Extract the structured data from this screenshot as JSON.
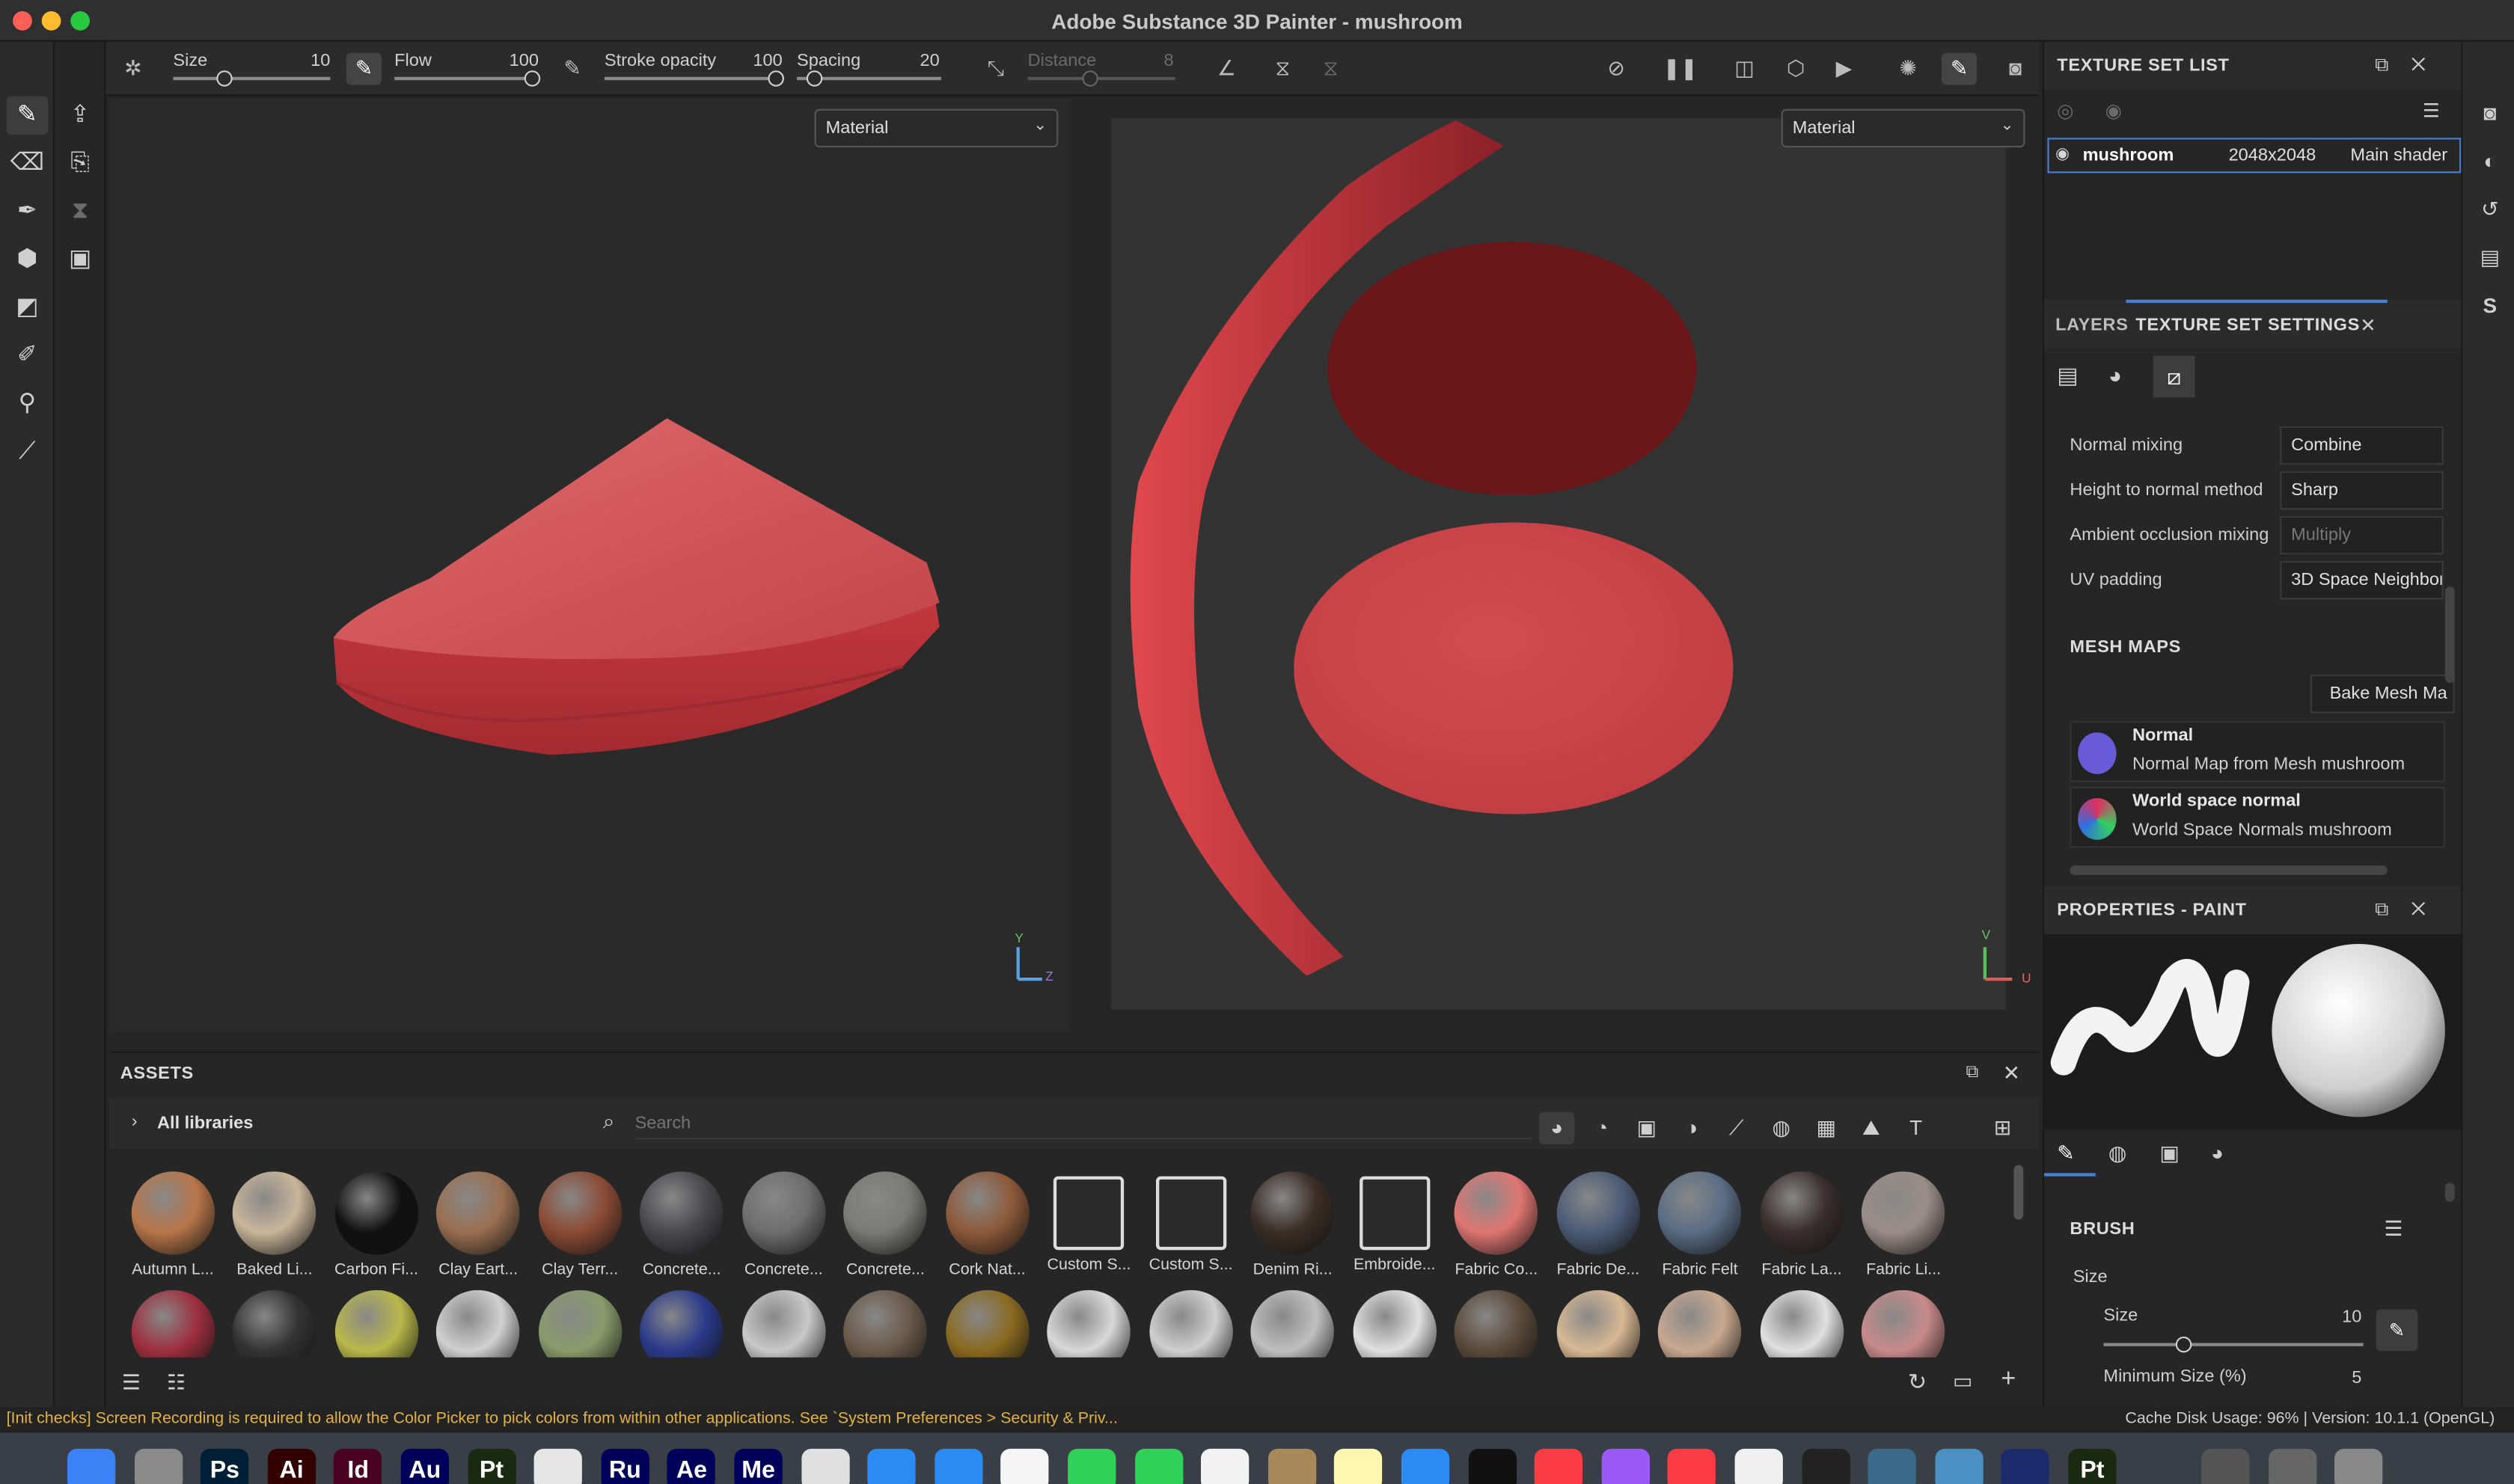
{
  "window": {
    "title": "Adobe Substance 3D Painter - mushroom"
  },
  "toolbar": {
    "size_label": "Size",
    "size_value": "10",
    "flow_label": "Flow",
    "flow_value": "100",
    "stroke_opacity_label": "Stroke opacity",
    "stroke_opacity_value": "100",
    "spacing_label": "Spacing",
    "spacing_value": "20",
    "distance_label": "Distance",
    "distance_value": "8"
  },
  "viewport_3d": {
    "mode": "Material",
    "axis_y": "Y",
    "axis_z": "Z"
  },
  "viewport_2d": {
    "mode": "Material",
    "axis_v": "V",
    "axis_u": "U"
  },
  "assets": {
    "title": "ASSETS",
    "library": "All libraries",
    "search_placeholder": "Search",
    "row1": [
      {
        "label": "Autumn L...",
        "color": "#b8764a"
      },
      {
        "label": "Baked Li...",
        "color": "#c9b59a"
      },
      {
        "label": "Carbon Fi...",
        "color": "#111111"
      },
      {
        "label": "Clay Eart...",
        "color": "#9a6f52"
      },
      {
        "label": "Clay Terr...",
        "color": "#8c4b35"
      },
      {
        "label": "Concrete...",
        "color": "#4a4a4e"
      },
      {
        "label": "Concrete...",
        "color": "#6e6e6e"
      },
      {
        "label": "Concrete...",
        "color": "#7a7a76"
      },
      {
        "label": "Cork Nat...",
        "color": "#8e5a3a"
      },
      {
        "label": "Custom S...",
        "color": "#dcdcdc"
      },
      {
        "label": "Custom S...",
        "color": "#dcdcdc"
      },
      {
        "label": "Denim Ri...",
        "color": "#3a2e26"
      },
      {
        "label": "Embroide...",
        "color": "#dcdcdc"
      },
      {
        "label": "Fabric Co...",
        "color": "#e07672"
      },
      {
        "label": "Fabric De...",
        "color": "#4c5d78"
      },
      {
        "label": "Fabric Felt",
        "color": "#5a6e86"
      },
      {
        "label": "Fabric La...",
        "color": "#3a2e2e"
      },
      {
        "label": "Fabric Li...",
        "color": "#9a8d88"
      }
    ],
    "row2_colors": [
      "#9e2f3e",
      "#333333",
      "#b8b84a",
      "#d0d0d0",
      "#8a9a6a",
      "#2a3a8a",
      "#c8c8c8",
      "#6a5a4a",
      "#8a6a20",
      "#d8d8d8",
      "#cfcfcf",
      "#bfbfbf",
      "#e0e0e0",
      "#5a4a3a",
      "#d8b894",
      "#c8a890",
      "#e0e0e0",
      "#c88a8a"
    ]
  },
  "status": {
    "warning": "[Init checks] Screen Recording is required to allow the Color Picker to pick colors from within other applications. See `System Preferences > Security & Priv...",
    "cache": "Cache Disk Usage:    96% | Version: 10.1.1 (OpenGL)"
  },
  "texture_set_list": {
    "title": "TEXTURE SET LIST",
    "row": {
      "name": "mushroom",
      "resolution": "2048x2048",
      "shader": "Main shader"
    }
  },
  "texture_settings": {
    "tab_layers": "LAYERS",
    "tab_settings": "TEXTURE SET SETTINGS",
    "fields": [
      {
        "label": "Normal mixing",
        "value": "Combine"
      },
      {
        "label": "Height to normal method",
        "value": "Sharp"
      },
      {
        "label": "Ambient occlusion mixing",
        "value": "Multiply"
      },
      {
        "label": "UV padding",
        "value": "3D Space Neighbor"
      }
    ],
    "mesh_maps_title": "MESH MAPS",
    "bake_button": "Bake Mesh Ma",
    "mesh_maps": [
      {
        "title": "Normal",
        "subtitle": "Normal Map from Mesh mushroom"
      },
      {
        "title": "World space normal",
        "subtitle": "World Space Normals mushroom"
      }
    ]
  },
  "properties": {
    "title": "PROPERTIES - PAINT",
    "brush_title": "BRUSH",
    "size_group": "Size",
    "size_label": "Size",
    "size_value": "10",
    "min_size_label": "Minimum Size (%)",
    "min_size_value": "5"
  },
  "dock": [
    {
      "label": "",
      "color": "#3b82f6"
    },
    {
      "label": "",
      "color": "#8a8a8a"
    },
    {
      "label": "Ps",
      "color": "#001e36"
    },
    {
      "label": "Ai",
      "color": "#330000"
    },
    {
      "label": "Id",
      "color": "#49021f"
    },
    {
      "label": "Au",
      "color": "#00005b"
    },
    {
      "label": "Pt",
      "color": "#1a2a10"
    },
    {
      "label": "",
      "color": "#e5e5e5"
    },
    {
      "label": "Ru",
      "color": "#00005b"
    },
    {
      "label": "Ae",
      "color": "#00005b"
    },
    {
      "label": "Me",
      "color": "#00005b"
    },
    {
      "label": "",
      "color": "#e0e0e0"
    },
    {
      "label": "",
      "color": "#2a8bf2"
    },
    {
      "label": "",
      "color": "#2a8bf2"
    },
    {
      "label": "",
      "color": "#f5f5f5"
    },
    {
      "label": "",
      "color": "#30d158"
    },
    {
      "label": "",
      "color": "#30d158"
    },
    {
      "label": "",
      "color": "#f2f2f2"
    },
    {
      "label": "",
      "color": "#a88a5a"
    },
    {
      "label": "",
      "color": "#fff6b0"
    },
    {
      "label": "",
      "color": "#2a8bf2"
    },
    {
      "label": "",
      "color": "#111111"
    },
    {
      "label": "",
      "color": "#fc3c44"
    },
    {
      "label": "",
      "color": "#9b59f5"
    },
    {
      "label": "",
      "color": "#fc3c44"
    },
    {
      "label": "",
      "color": "#f0f0f0"
    },
    {
      "label": "",
      "color": "#222222"
    },
    {
      "label": "",
      "color": "#3a6a8a"
    },
    {
      "label": "",
      "color": "#4a90c2"
    },
    {
      "label": "",
      "color": "#1a2a6a"
    },
    {
      "label": "Pt",
      "color": "#1a2a10"
    },
    {
      "label": "",
      "color": "#3a3f47"
    },
    {
      "label": "",
      "color": "#555555"
    },
    {
      "label": "",
      "color": "#666666"
    },
    {
      "label": "",
      "color": "#888888"
    }
  ],
  "colors": {
    "accent": "#4a7fd0",
    "warning": "#e3b23c",
    "mushroom_red": "#c0393e"
  }
}
